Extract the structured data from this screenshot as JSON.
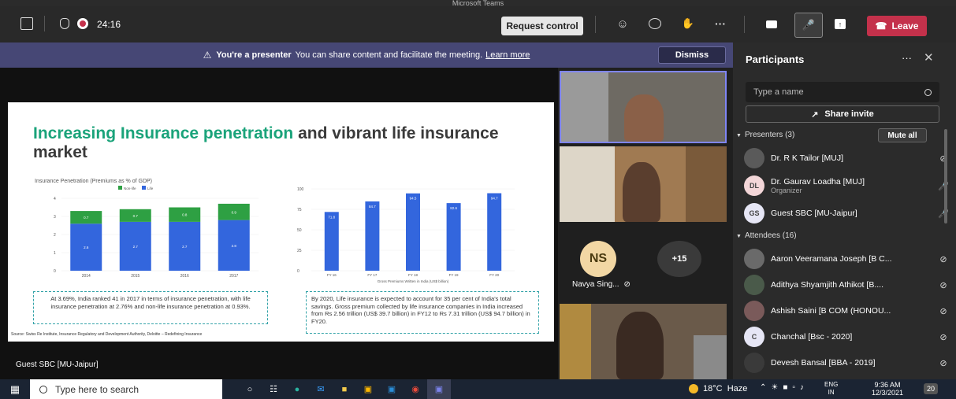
{
  "window": {
    "title": "Microsoft Teams"
  },
  "topbar": {
    "timer": "24:16",
    "request_control": "Request control",
    "leave": "Leave"
  },
  "banner": {
    "bold": "You're a presenter",
    "text": "You can share content and facilitate the meeting.",
    "link": "Learn more",
    "dismiss": "Dismiss"
  },
  "slide": {
    "title_green": "Increasing Insurance penetration",
    "title_rest": " and vibrant life insurance market",
    "note1": "At 3.69%, India ranked 41 in 2017 in terms of insurance penetration, with life insurance penetration at 2.76% and non-life insurance penetration at 0.93%.",
    "note2": "By 2020, Life insurance is expected to account for 35 per cent of India's total savings. Gross premium collected by life insurance companies in India increased from Rs 2.56 trillion (US$ 39.7 billion) in FY12 to Rs 7.31 trillion (US$ 94.7 billion) in FY20.",
    "source": "Source: Swiss Re Institute, Insurance Regulatory and Development Authority, Deloitte – Redefining Insurance"
  },
  "chart_data": [
    {
      "type": "bar",
      "title": "Insurance Penetration (Premiums as % of GDP)",
      "categories": [
        "2014",
        "2015",
        "2016",
        "2017"
      ],
      "series": [
        {
          "name": "Life",
          "values": [
            2.6,
            2.7,
            2.7,
            2.8
          ],
          "color": "#3366dd"
        },
        {
          "name": "Non-life",
          "values": [
            0.7,
            0.7,
            0.8,
            0.9
          ],
          "color": "#2ea043"
        }
      ],
      "ylim": [
        0,
        4
      ],
      "yticks": [
        "0",
        "1",
        "2",
        "3",
        "4"
      ],
      "stacked": true,
      "legend": "top"
    },
    {
      "type": "bar",
      "xlabel": "Gross Premiums Written in India (US$ billion)",
      "categories": [
        "FY 16",
        "FY 17",
        "FY 18",
        "FY 19",
        "FY 20"
      ],
      "values": [
        71.8,
        84.7,
        94.5,
        82.6,
        94.7
      ],
      "color": "#3366dd",
      "ylim": [
        0,
        100
      ],
      "yticks": [
        "0",
        "25",
        "50",
        "75",
        "100"
      ]
    }
  ],
  "tiles": {
    "navya_initials": "NS",
    "navya_name": "Navya Sing...",
    "more": "+15",
    "bottom_label": "Guest SBC [MU-Jaipur]"
  },
  "panel": {
    "title": "Participants",
    "search_placeholder": "Type a name",
    "share_invite": "Share invite",
    "presenters_header": "Presenters (3)",
    "mute_all": "Mute all",
    "attendees_header": "Attendees (16)",
    "presenters": [
      {
        "name": "Dr. R K Tailor [MUJ]",
        "initials": "",
        "sub": "",
        "color": "#5a5a5a",
        "mic": "muted"
      },
      {
        "name": "Dr. Gaurav Loadha [MUJ]",
        "initials": "DL",
        "sub": "Organizer",
        "color": "#f3d6d8",
        "mic": "on"
      },
      {
        "name": "Guest SBC [MU-Jaipur]",
        "initials": "GS",
        "sub": "",
        "color": "#e6e6f5",
        "mic": "on"
      }
    ],
    "attendees": [
      {
        "name": "Aaron Veeramana Joseph [B C...",
        "initials": "",
        "color": "#6a6a6a",
        "mic": "muted"
      },
      {
        "name": "Adithya Shyamjith Athikot [B....",
        "initials": "",
        "color": "#4a5a4a",
        "mic": "muted"
      },
      {
        "name": "Ashish Saini [B COM (HONOU...",
        "initials": "",
        "color": "#7a5a5a",
        "mic": "muted"
      },
      {
        "name": "Chanchal [Bsc - 2020]",
        "initials": "C",
        "color": "#e6e6f5",
        "mic": "muted"
      },
      {
        "name": "Devesh Bansal [BBA - 2019]",
        "initials": "",
        "color": "#3a3a3a",
        "mic": "muted"
      }
    ]
  },
  "taskbar": {
    "search": "Type here to search",
    "weather": "18°C  Haze",
    "lang": "ENG",
    "region": "IN",
    "time": "9:36 AM",
    "date": "12/3/2021",
    "notif": "20"
  }
}
